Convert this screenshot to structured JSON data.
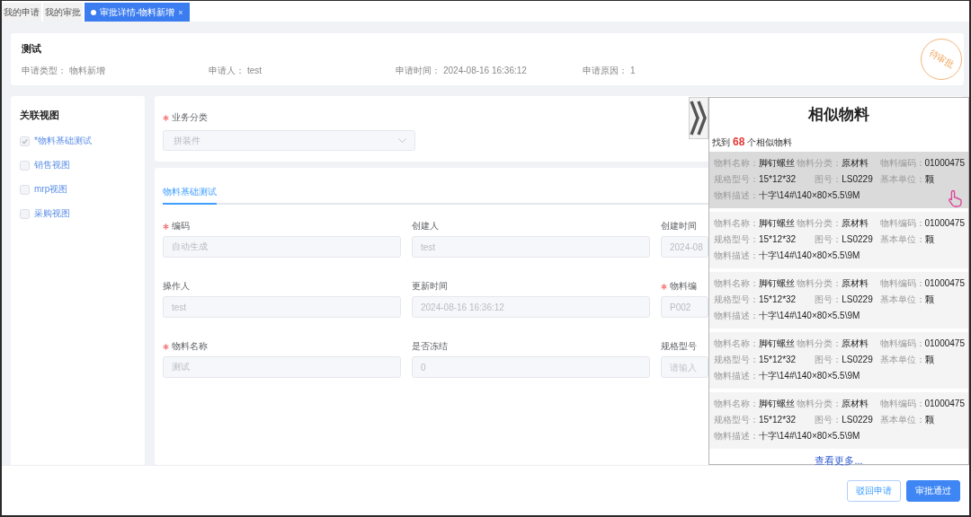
{
  "tabs": [
    {
      "label": "我的申请",
      "selected": false
    },
    {
      "label": "我的审批",
      "selected": false
    },
    {
      "label": "审批详情-物料新增",
      "selected": true,
      "close": "×"
    }
  ],
  "header": {
    "title": "测试",
    "fields": [
      {
        "label": "申请类型：",
        "value": "物料新增"
      },
      {
        "label": "申请人：",
        "value": "test"
      },
      {
        "label": "申请时间：",
        "value": "2024-08-16 16:36:12"
      },
      {
        "label": "申请原因：",
        "value": "1"
      }
    ],
    "stamp": "待审批"
  },
  "sidebar": {
    "title": "关联视图",
    "items": [
      {
        "label": "*物料基础测试",
        "checked": true
      },
      {
        "label": "销售视图",
        "checked": false
      },
      {
        "label": "mrp视图",
        "checked": false
      },
      {
        "label": "采购视图",
        "checked": false
      }
    ]
  },
  "category": {
    "label": "业务分类",
    "required": true,
    "value": "拼装件",
    "disabled": true
  },
  "form": {
    "disabled": true,
    "tabs": [
      {
        "label": "物料基础测试",
        "selected": true
      }
    ],
    "fields": [
      {
        "label": "编码",
        "required": true,
        "value": "自动生成"
      },
      {
        "label": "创建人",
        "required": false,
        "value": "test"
      },
      {
        "label": "创建时间",
        "required": false,
        "value": "2024-08"
      },
      {
        "label": "操作人",
        "required": false,
        "value": "test"
      },
      {
        "label": "更新时间",
        "required": false,
        "value": "2024-08-16 16:36:12"
      },
      {
        "label": "物料编",
        "required": true,
        "value": "P002"
      },
      {
        "label": "物料名称",
        "required": true,
        "value": "测试"
      },
      {
        "label": "是否冻结",
        "required": false,
        "value": "0"
      },
      {
        "label": "规格型号",
        "required": false,
        "placeholder": "请输入"
      }
    ]
  },
  "similar_panel": {
    "title": "相似物料",
    "summary": {
      "prefix": "找到",
      "count": "68",
      "suffix": "个相似物料"
    },
    "items": [
      {
        "hovered": true,
        "fields": [
          {
            "label": "物料名称：",
            "value": "脚钉螺丝"
          },
          {
            "label": "物料分类：",
            "value": "原材料"
          },
          {
            "label": "物料编码：",
            "value": "01000475"
          },
          {
            "label": "规格型号：",
            "value": "15*12*32"
          },
          {
            "label": "图号：",
            "value": "LS0229"
          },
          {
            "label": "基本单位：",
            "value": "颗"
          },
          {
            "label": "物料描述：",
            "value": "十字\\14#\\140×80×5.5\\9M"
          }
        ]
      },
      {
        "hovered": false,
        "fields": [
          {
            "label": "物料名称：",
            "value": "脚钉螺丝"
          },
          {
            "label": "物料分类：",
            "value": "原材料"
          },
          {
            "label": "物料编码：",
            "value": "01000475"
          },
          {
            "label": "规格型号：",
            "value": "15*12*32"
          },
          {
            "label": "图号：",
            "value": "LS0229"
          },
          {
            "label": "基本单位：",
            "value": "颗"
          },
          {
            "label": "物料描述：",
            "value": "十字\\14#\\140×80×5.5\\9M"
          }
        ]
      },
      {
        "hovered": false,
        "fields": [
          {
            "label": "物料名称：",
            "value": "脚钉螺丝"
          },
          {
            "label": "物料分类：",
            "value": "原材料"
          },
          {
            "label": "物料编码：",
            "value": "01000475"
          },
          {
            "label": "规格型号：",
            "value": "15*12*32"
          },
          {
            "label": "图号：",
            "value": "LS0229"
          },
          {
            "label": "基本单位：",
            "value": "颗"
          },
          {
            "label": "物料描述：",
            "value": "十字\\14#\\140×80×5.5\\9M"
          }
        ]
      },
      {
        "hovered": false,
        "fields": [
          {
            "label": "物料名称：",
            "value": "脚钉螺丝"
          },
          {
            "label": "物料分类：",
            "value": "原材料"
          },
          {
            "label": "物料编码：",
            "value": "01000475"
          },
          {
            "label": "规格型号：",
            "value": "15*12*32"
          },
          {
            "label": "图号：",
            "value": "LS0229"
          },
          {
            "label": "基本单位：",
            "value": "颗"
          },
          {
            "label": "物料描述：",
            "value": "十字\\14#\\140×80×5.5\\9M"
          }
        ]
      },
      {
        "hovered": false,
        "fields": [
          {
            "label": "物料名称：",
            "value": "脚钉螺丝"
          },
          {
            "label": "物料分类：",
            "value": "原材料"
          },
          {
            "label": "物料编码：",
            "value": "01000475"
          },
          {
            "label": "规格型号：",
            "value": "15*12*32"
          },
          {
            "label": "图号：",
            "value": "LS0229"
          },
          {
            "label": "基本单位：",
            "value": "颗"
          },
          {
            "label": "物料描述：",
            "value": "十字\\14#\\140×80×5.5\\9M"
          }
        ]
      }
    ],
    "more_link": "查看更多..."
  },
  "actions": [
    {
      "label": "驳回申请",
      "kind": "secondary"
    },
    {
      "label": "审批通过",
      "kind": "primary"
    }
  ]
}
